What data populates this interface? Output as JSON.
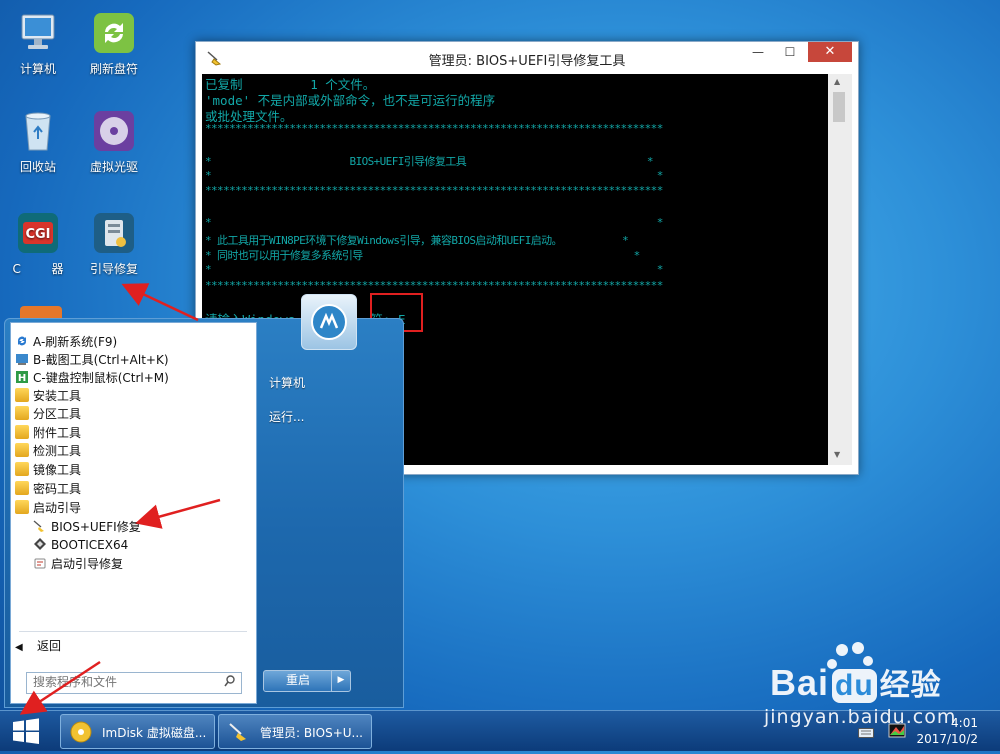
{
  "desktop": {
    "icons": [
      {
        "label": "计算机",
        "icon": "computer-icon"
      },
      {
        "label": "刷新盘符",
        "icon": "refresh-icon"
      },
      {
        "label": "回收站",
        "icon": "recycle-bin-icon"
      },
      {
        "label": "虚拟光驱",
        "icon": "virtual-drive-icon"
      },
      {
        "label": "C        器",
        "icon": "cgi-icon"
      },
      {
        "label": "引导修复",
        "icon": "boot-repair-icon"
      }
    ]
  },
  "console": {
    "title": "管理员: BIOS+UEFI引导修复工具",
    "lines": [
      "已复制         1 个文件。",
      "'mode' 不是内部或外部命令，也不是可运行的程序",
      "或批处理文件。",
      "****************************************************************************",
      "*                       BIOS+UEFI引导修复工具                              *",
      "*                                                                          *",
      "****************************************************************************",
      "*                                                                          *",
      "* 此工具用于WIN8PE环境下修复Windows引导，兼容BIOS启动和UEFI启动。          *",
      "* 同时也可以用于修复多系统引导                                             *",
      "*                                                                          *",
      "****************************************************************************",
      "请输入Windows          符: E"
    ],
    "highlight_text": "E"
  },
  "start_menu": {
    "items": [
      {
        "label": "A-刷新系统(F9)",
        "icon": "refresh-icon"
      },
      {
        "label": "B-截图工具(Ctrl+Alt+K)",
        "icon": "screenshot-icon"
      },
      {
        "label": "C-键盘控制鼠标(Ctrl+M)",
        "icon": "keyboard-mouse-icon"
      },
      {
        "label": "安装工具",
        "icon": "folder-icon"
      },
      {
        "label": "分区工具",
        "icon": "folder-icon"
      },
      {
        "label": "附件工具",
        "icon": "folder-icon"
      },
      {
        "label": "检测工具",
        "icon": "folder-icon"
      },
      {
        "label": "镜像工具",
        "icon": "folder-icon"
      },
      {
        "label": "密码工具",
        "icon": "folder-icon"
      },
      {
        "label": "启动引导",
        "icon": "folder-icon"
      }
    ],
    "subitems": [
      {
        "label": "BIOS+UEFI修复",
        "icon": "boot-repair-icon"
      },
      {
        "label": "BOOTICEX64",
        "icon": "bootice-icon"
      },
      {
        "label": "启动引导修复",
        "icon": "repair-icon"
      }
    ],
    "back_label": "返回",
    "search_placeholder": "搜索程序和文件",
    "right_items": [
      "计算机",
      "运行..."
    ],
    "restart_label": "重启"
  },
  "taskbar": {
    "buttons": [
      {
        "label": "ImDisk 虚拟磁盘...",
        "icon": "imdisk-icon"
      },
      {
        "label": "管理员: BIOS+U...",
        "icon": "boot-repair-icon"
      }
    ],
    "time": "4:01",
    "date": "2017/10/2"
  },
  "watermark": {
    "brand": "Bai",
    "brand2": "du",
    "cn": "经验",
    "url": "jingyan.baidu.com"
  },
  "colors": {
    "console_text": "#12a7a7",
    "highlight_box": "#e02020",
    "annotation_arrow": "#e02020"
  }
}
